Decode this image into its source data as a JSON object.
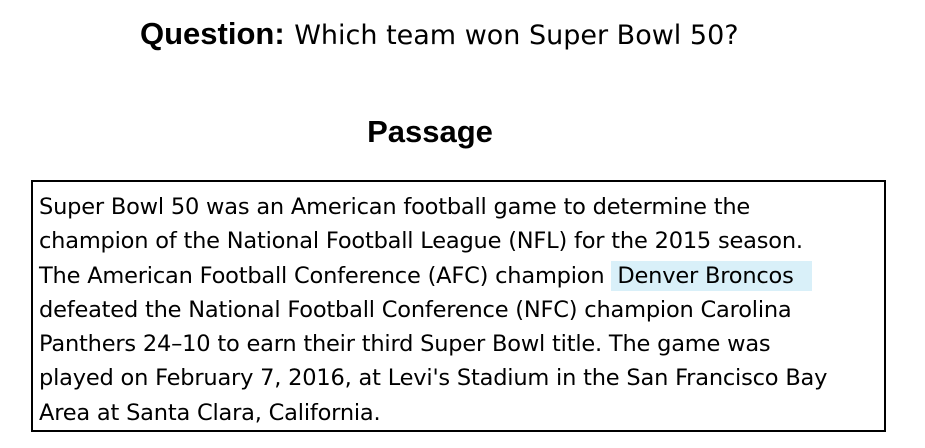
{
  "question": {
    "label": "Question:",
    "text": "Which team won Super Bowl 50?"
  },
  "passage": {
    "title": "Passage",
    "lines": [
      "Super Bowl 50 was an American football game to determine the",
      "champion of the National Football League (NFL) for the 2015 season.",
      "The American Football Conference (AFC) champion",
      "defeated the National Football Conference (NFC) champion Carolina",
      "Panthers 24–10 to earn their third Super Bowl title. The game was",
      "played on February 7, 2016, at Levi's Stadium in the San Francisco Bay",
      "Area at Santa Clara, California."
    ],
    "answer_span": "Denver Broncos",
    "highlight_color": "#d9f0f9"
  }
}
